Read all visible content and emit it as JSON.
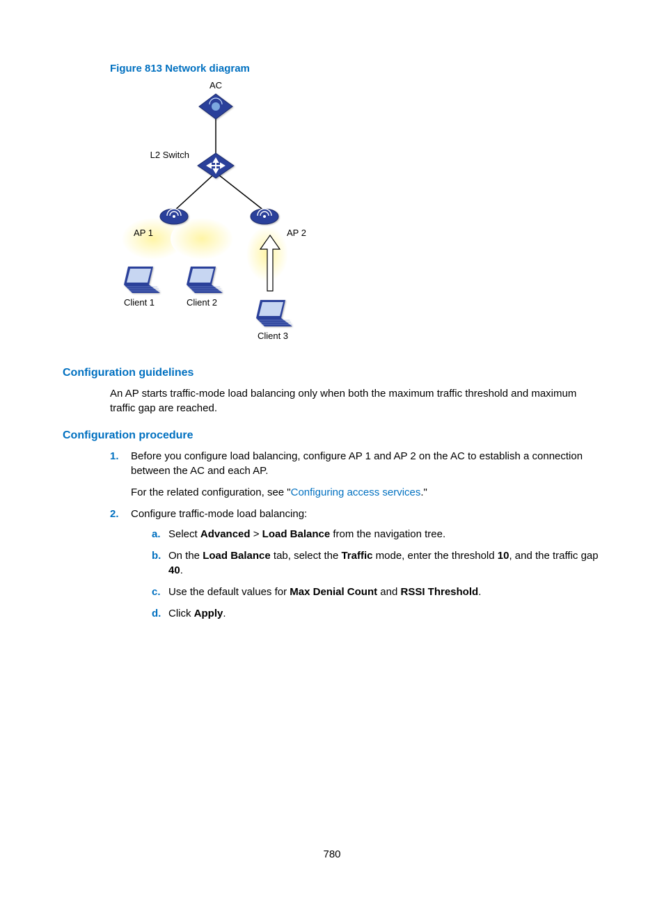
{
  "figure": {
    "caption": "Figure 813 Network diagram",
    "nodes": {
      "ac": "AC",
      "l2switch": "L2 Switch",
      "ap1": "AP 1",
      "ap2": "AP 2",
      "client1": "Client 1",
      "client2": "Client 2",
      "client3": "Client 3"
    }
  },
  "sections": {
    "guidelines": {
      "title": "Configuration guidelines",
      "body": "An AP starts traffic-mode load balancing only when both the maximum traffic threshold and maximum traffic gap are reached."
    },
    "procedure": {
      "title": "Configuration procedure",
      "steps": [
        {
          "marker": "1.",
          "para1": "Before you configure load balancing, configure AP 1 and AP 2 on the AC to establish a connection between the AC and each AP.",
          "para2_pre": "For the related configuration, see \"",
          "link": "Configuring access services",
          "para2_post": ".\""
        },
        {
          "marker": "2.",
          "para1": "Configure traffic-mode load balancing:",
          "sub": [
            {
              "amarker": "a.",
              "pre": "Select ",
              "b1": "Advanced",
              "mid1": " > ",
              "b2": "Load Balance",
              "post": " from the navigation tree."
            },
            {
              "amarker": "b.",
              "pre": "On the ",
              "b1": "Load Balance",
              "mid1": " tab, select the ",
              "b2": "Traffic",
              "mid2": " mode, enter the threshold ",
              "b3": "10",
              "mid3": ", and the traffic gap ",
              "b4": "40",
              "post": "."
            },
            {
              "amarker": "c.",
              "pre": "Use the default values for ",
              "b1": "Max Denial Count",
              "mid1": " and ",
              "b2": "RSSI Threshold",
              "post": "."
            },
            {
              "amarker": "d.",
              "pre": "Click ",
              "b1": "Apply",
              "post": "."
            }
          ]
        }
      ]
    }
  },
  "pageNumber": "780"
}
